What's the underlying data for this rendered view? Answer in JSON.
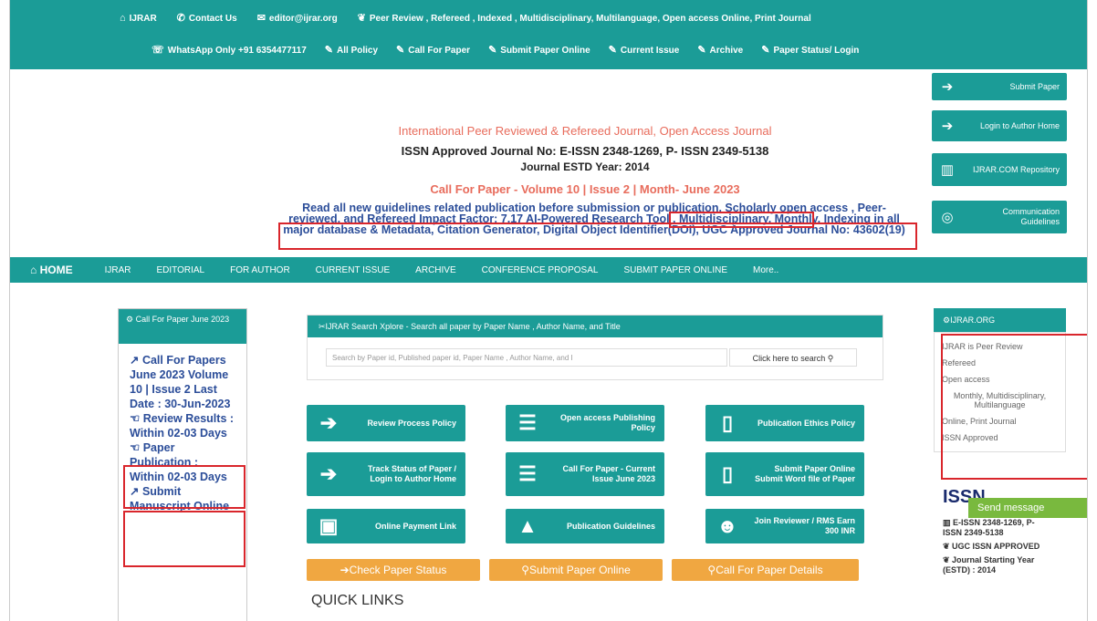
{
  "topbar": {
    "row1": {
      "home": "IJRAR",
      "contact": "Contact Us",
      "email": "editor@ijrar.org",
      "tagline": "Peer Review , Refereed , Indexed , Multidisciplinary, Multilanguage, Open access Online, Print Journal"
    },
    "row2": {
      "whatsapp": "WhatsApp Only +91 6354477117",
      "all_policy": "All Policy",
      "call_for_paper": "Call For Paper",
      "submit_paper_online": "Submit Paper Online",
      "current_issue": "Current Issue",
      "archive": "Archive",
      "paper_status_login": "Paper Status/ Login"
    }
  },
  "right_buttons": {
    "submit_paper": "Submit Paper",
    "login_author_home": "Login to Author Home",
    "repository": "IJRAR.COM Repository",
    "communication": "Communication Guidelines"
  },
  "header": {
    "line1": "International Peer Reviewed & Refereed Journal, Open Access Journal",
    "line2": "ISSN Approved Journal No: E-ISSN 2348-1269, P- ISSN 2349-5138",
    "line3": "Journal ESTD Year: 2014",
    "line4": "Call For Paper - Volume 10 | Issue 2 | Month- June 2023",
    "guidelines": "Read all new guidelines related publication before submission or publication. Scholarly open access , Peer-reviewed, and Refereed Impact Factor: 7.17 AI-Powered Research Tool , Multidisciplinary, Monthly, Indexing in all major database & Metadata, Citation Generator, Digital Object Identifier(DOI), UGC Approved Journal No: 43602(19)"
  },
  "nav": {
    "home": "HOME",
    "items": [
      "IJRAR",
      "EDITORIAL",
      "FOR AUTHOR",
      "CURRENT ISSUE",
      "ARCHIVE",
      "CONFERENCE PROPOSAL",
      "SUBMIT PAPER ONLINE",
      "More.."
    ]
  },
  "left_panel": {
    "header": "Call For Paper June 2023",
    "body": "Call For Papers June 2023 Volume 10 | Issue 2 Last Date : 30-Jun-2023",
    "review": "Review Results : Within 02-03 Days",
    "publication": "Paper Publication : Within 02-03 Days",
    "submit": "Submit Manuscript Online"
  },
  "search": {
    "header": "IJRAR Search Xplore - Search all paper by Paper Name , Author Name, and Title",
    "placeholder": "Search by Paper id, Published paper id, Paper Name , Author Name, and I",
    "button": "Click here to search"
  },
  "tiles": [
    {
      "label": "Review Process Policy"
    },
    {
      "label": "Open access Publishing Policy"
    },
    {
      "label": "Publication Ethics Policy"
    },
    {
      "label": "Track Status of Paper / Login to Author Home"
    },
    {
      "label": "Call For Paper - Current Issue June 2023"
    },
    {
      "label": "Submit Paper Online Submit Word file of Paper"
    },
    {
      "label": "Online Payment Link"
    },
    {
      "label": "Publication Guidelines"
    },
    {
      "label": "Join Reviewer / RMS Earn 300 INR"
    }
  ],
  "orange_buttons": {
    "check_status": "Check Paper Status",
    "submit_online": "Submit Paper Online",
    "call_details": "Call For Paper Details"
  },
  "quick_links": "QUICK LINKS",
  "right_panel": {
    "header": "IJRAR.ORG",
    "items": [
      "IJRAR is Peer Review",
      "Refereed",
      "Open access",
      "Monthly, Multidisciplinary, Multilanguage",
      "Online, Print Journal",
      "ISSN Approved"
    ]
  },
  "send_message": "Send message",
  "right_info": {
    "issn": "E-ISSN 2348-1269, P- ISSN 2349-5138",
    "ugc": "UGC ISSN APPROVED",
    "start": "Journal Starting Year (ESTD) : 2014"
  },
  "colors": {
    "teal": "#1b9c97",
    "orange": "#f0a741",
    "red_box": "#d9262c",
    "blue_text": "#2b4d99",
    "green": "#79b93e"
  }
}
